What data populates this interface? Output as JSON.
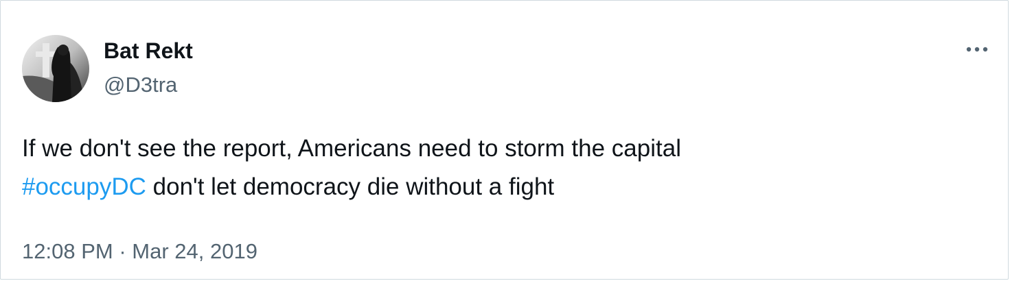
{
  "author": {
    "name": "Bat Rekt",
    "handle": "@D3tra"
  },
  "more_icon": "more-horizontal-icon",
  "tweet": {
    "line1": "If we don't see the report, Americans need to storm the capital",
    "hashtag": "#occupyDC",
    "line2_rest": " don't let democracy die without a fight"
  },
  "meta": {
    "time": "12:08 PM",
    "separator": " · ",
    "date": "Mar 24, 2019"
  },
  "colors": {
    "text": "#0f1419",
    "secondary": "#536471",
    "link": "#1d9bf0",
    "border": "#cfd9de"
  }
}
